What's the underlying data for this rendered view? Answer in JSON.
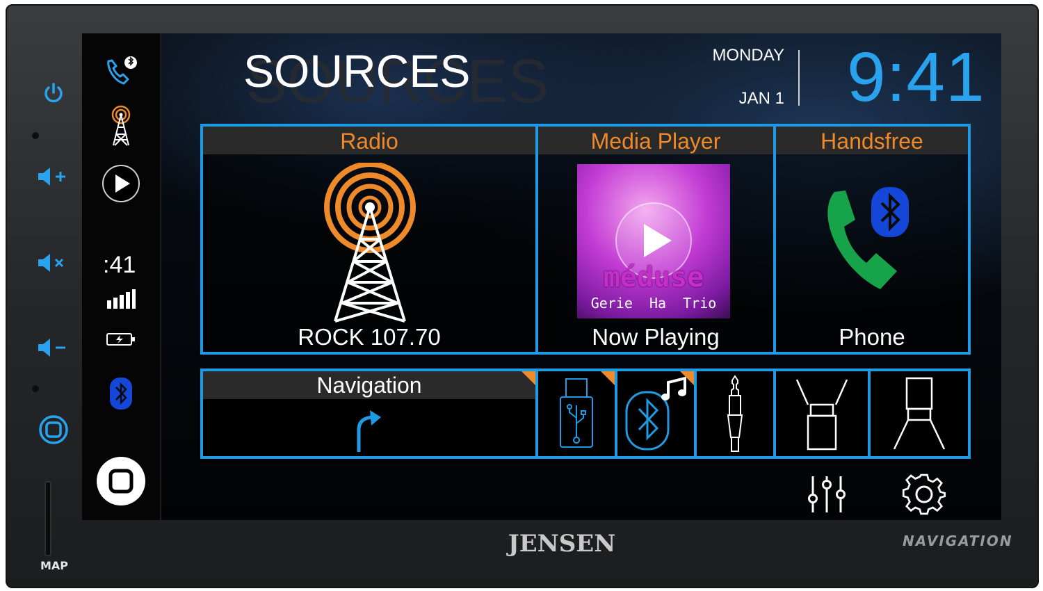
{
  "screen": {
    "title": "SOURCES",
    "title_ghost": "SOURCES",
    "day": "MONDAY",
    "date": "JAN 1",
    "clock": "9:41"
  },
  "sidebar": {
    "clock_fragment": ":41"
  },
  "tiles": {
    "radio": {
      "title": "Radio",
      "caption": "ROCK 107.70"
    },
    "media": {
      "title": "Media Player",
      "caption": "Now Playing",
      "album_title": "méduse",
      "album_subtitle": "Gerie  Ha  Trio"
    },
    "handsfree": {
      "title": "Handsfree",
      "caption": "Phone"
    },
    "navigation": {
      "title": "Navigation"
    }
  },
  "hardware": {
    "brand": "JENSEN",
    "nav_tag": "NAVIGATION",
    "map_label": "MAP"
  },
  "colors": {
    "accent_blue": "#1f9be6",
    "tile_title_orange": "#ee8a2a",
    "phone_green": "#17a34a",
    "bluetooth_blue": "#1447d8"
  },
  "icons": [
    "power-icon",
    "volume-up-icon",
    "mute-icon",
    "volume-down-icon",
    "home-hw-icon",
    "phone-bluetooth-icon",
    "radio-tower-icon",
    "play-icon",
    "signal-bars-icon",
    "battery-charging-icon",
    "bluetooth-icon",
    "home-icon",
    "usb-icon",
    "bluetooth-music-icon",
    "aux-jack-icon",
    "camera-front-icon",
    "camera-rear-icon",
    "equalizer-icon",
    "settings-gear-icon",
    "turn-right-icon"
  ]
}
